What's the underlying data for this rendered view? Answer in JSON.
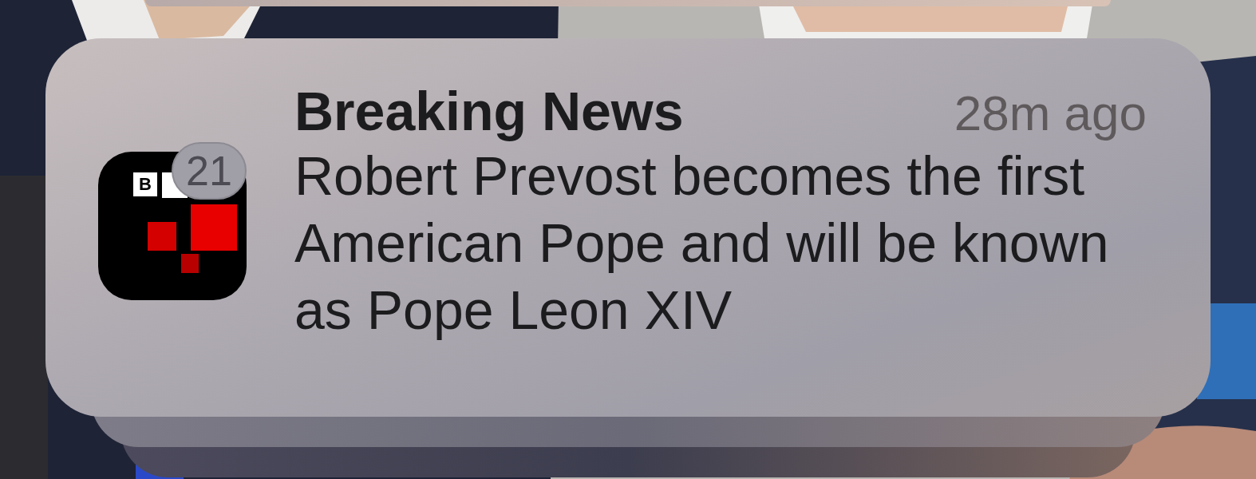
{
  "notification": {
    "app_icon": {
      "letters": [
        "B"
      ]
    },
    "badge": "21",
    "title": "Breaking News",
    "time": "28m ago",
    "body": "Robert Prevost becomes the first American Pope and will be known as Pope Leon XIV"
  }
}
